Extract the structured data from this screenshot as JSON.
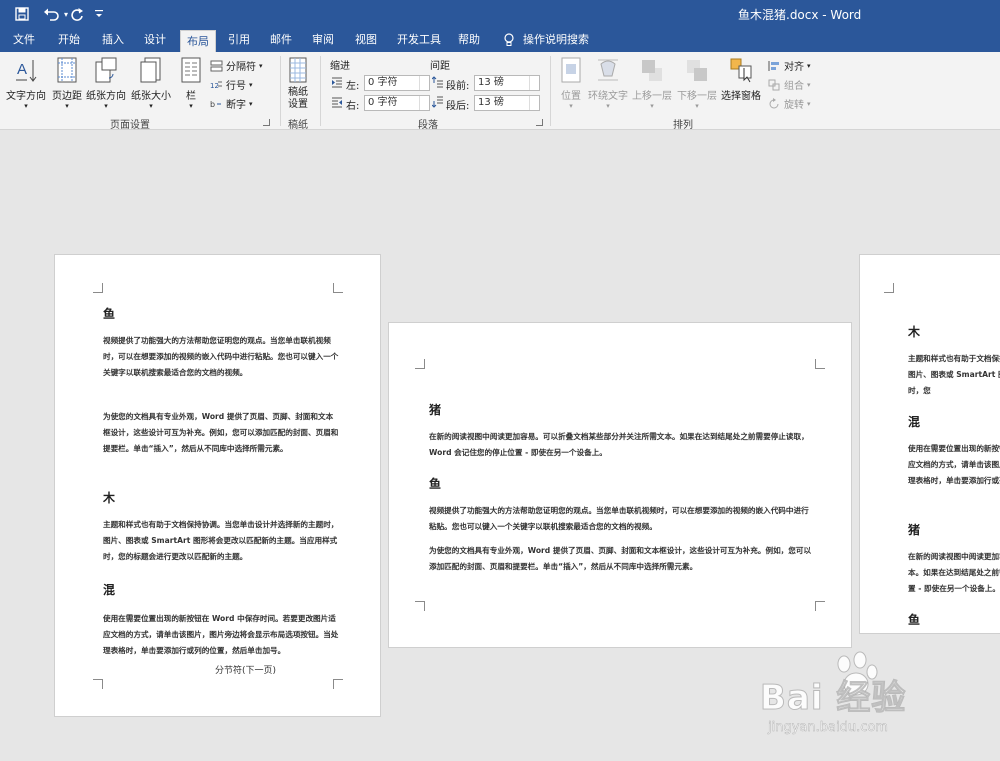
{
  "window": {
    "title": "鱼木混猪.docx  -  Word"
  },
  "quick_access": {
    "save_icon": "save-icon",
    "undo_icon": "undo-icon",
    "redo_icon": "redo-icon",
    "customize_icon": "customize-icon"
  },
  "tabs": [
    "文件",
    "开始",
    "插入",
    "设计",
    "布局",
    "引用",
    "邮件",
    "审阅",
    "视图",
    "开发工具",
    "帮助",
    "操作说明搜索"
  ],
  "active_tab": "布局",
  "ribbon": {
    "page_setup": {
      "label": "页面设置",
      "text_direction": "文字方向",
      "margins": "页边距",
      "orientation": "纸张方向",
      "size": "纸张大小",
      "columns": "栏",
      "breaks": "分隔符",
      "line_numbers": "行号",
      "hyphenation": "断字"
    },
    "manuscript": {
      "label": "稿纸",
      "button": "稿纸\n设置"
    },
    "paragraph": {
      "label": "段落",
      "indent_header": "缩进",
      "spacing_header": "间距",
      "indent_left_label": "左:",
      "indent_left_value": "0 字符",
      "indent_right_label": "右:",
      "indent_right_value": "0 字符",
      "spacing_before_label": "段前:",
      "spacing_before_value": "13 磅",
      "spacing_after_label": "段后:",
      "spacing_after_value": "13 磅"
    },
    "arrange": {
      "label": "排列",
      "position": "位置",
      "wrap_text": "环绕文字",
      "bring_forward": "上移一层",
      "send_backward": "下移一层",
      "selection_pane": "选择窗格",
      "align": "对齐",
      "group": "组合",
      "rotate": "旋转"
    }
  },
  "pages": {
    "left": {
      "h_yu": "鱼",
      "p1": "视频提供了功能强大的方法帮助您证明您的观点。当您单击联机视频时，可以在想要添加的视频的嵌入代码中进行粘贴。您也可以键入一个关键字以联机搜索最适合您的文档的视频。",
      "p2": "为使您的文档具有专业外观，Word 提供了页眉、页脚、封面和文本框设计，这些设计可互为补充。例如，您可以添加匹配的封面、页眉和提要栏。单击“插入”，然后从不同库中选择所需元素。",
      "h_mu": "木",
      "p3": "主题和样式也有助于文档保持协调。当您单击设计并选择新的主题时，图片、图表或 SmartArt 图形将会更改以匹配新的主题。当应用样式时，您的标题会进行更改以匹配新的主题。",
      "h_hun": "混",
      "p4": "使用在需要位置出现的新按钮在 Word 中保存时间。若要更改图片适应文档的方式，请单击该图片，图片旁边将会显示布局选项按钮。当处理表格时，单击要添加行或列的位置，然后单击加号。",
      "section_break": "分节符(下一页)"
    },
    "middle": {
      "h_zhu": "猪",
      "p1": "在新的阅读视图中阅读更加容易。可以折叠文档某些部分并关注所需文本。如果在达到结尾处之前需要停止读取，Word 会记住您的停止位置 - 即使在另一个设备上。",
      "h_yu": "鱼",
      "p2": "视频提供了功能强大的方法帮助您证明您的观点。当您单击联机视频时，可以在想要添加的视频的嵌入代码中进行粘贴。您也可以键入一个关键字以联机搜索最适合您的文档的视频。",
      "p3": "为使您的文档具有专业外观，Word 提供了页眉、页脚、封面和文本框设计，这些设计可互为补充。例如，您可以添加匹配的封面、页眉和提要栏。单击“插入”，然后从不同库中选择所需元素。"
    },
    "right": {
      "h_mu": "木",
      "p1": "主题和样式也有助于文档保持协调。当您单击设计并选择新的主题时，图片、图表或 SmartArt 图形将会更改以匹配新的主题。当应用样式时，您",
      "h_hun": "混",
      "p2": "使用在需要位置出现的新按钮在 Word 中保存时间。若要更改图片适应文档的方式，请单击该图片，图片旁边将会显示布局选项按钮。当处理表格时，单击要添加行或列的位置，然后单击加号。",
      "h_zhu": "猪",
      "p3": "在新的阅读视图中阅读更加容易。可以折叠文档某些部分并关注所需文本。如果在达到结尾处之前需要停止读取，Word 会记住您的停止位置 - 即使在另一个设备上。",
      "h_yu": "鱼"
    }
  },
  "watermark": {
    "text": "Bai 经验",
    "url": "jingyan.baidu.com"
  }
}
